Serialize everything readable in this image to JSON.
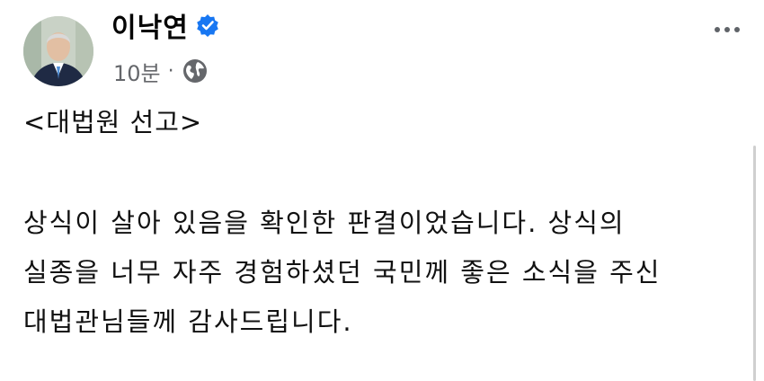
{
  "post": {
    "author": "이낙연",
    "time": "10분",
    "separator": "·",
    "audience_icon": "globe-icon",
    "verified_icon": "verified-badge-icon",
    "more_icon": "more-options-icon",
    "title": "<대법원 선고>",
    "lines": [
      "상식이 살아 있음을 확인한 판결이었습니다. 상식의",
      "실종을 너무 자주 경험하셨던 국민께 좋은 소식을 주신",
      "대법관님들께 감사드립니다."
    ]
  },
  "colors": {
    "verified_blue": "#1877f2",
    "meta_gray": "#65676b",
    "text": "#111111"
  }
}
